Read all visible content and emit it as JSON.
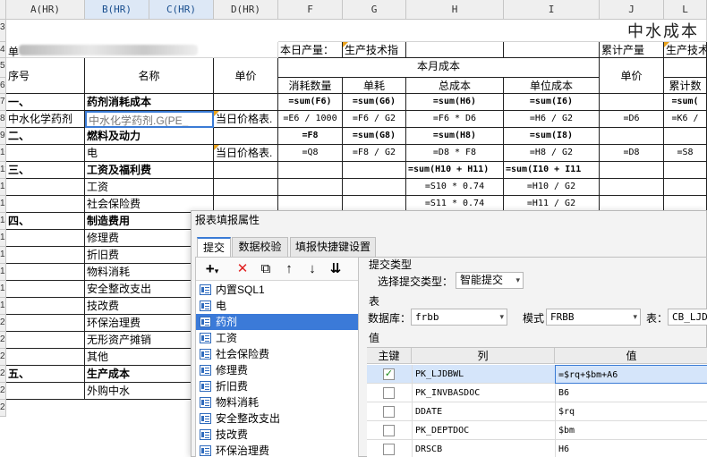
{
  "sheet": {
    "col_headers": [
      "A(HR)",
      "B(HR)",
      "C(HR)",
      "D(HR)",
      "F",
      "G",
      "H",
      "I",
      "J",
      "L"
    ],
    "row_headers": [
      "3",
      "4",
      "5",
      "6",
      "7",
      "8",
      "9",
      "10",
      "11",
      "12",
      "13",
      "14",
      "15",
      "16",
      "17",
      "18",
      "19",
      "20",
      "21",
      "22",
      "23",
      "24",
      "25"
    ],
    "title": "中水成本",
    "row4_prefix": "单",
    "daily_output_label": "本日产量：",
    "daily_output_value": "生产技术指",
    "cumulative_output_label": "累计产量",
    "cumulative_output_value": "生产技术",
    "monthly_cost_label": "本月成本",
    "col_seq": "序号",
    "col_name": "名称",
    "col_price": "单价",
    "col_consumption": "消耗数量",
    "col_unit_consumption": "单耗",
    "col_total_cost": "总成本",
    "col_unit_cost": "单位成本",
    "col_price2": "单价",
    "col_cumulative": "累计数",
    "rows": [
      {
        "seq": "一、",
        "name": "药剂消耗成本",
        "price": "",
        "f": "=sum(F6)",
        "g": "=sum(G6)",
        "h": "=sum(H6)",
        "i": "=sum(I6)",
        "j": "",
        "l": "=sum("
      },
      {
        "seq": "中水化学药剂",
        "name": "中水化学药剂.G(PE_",
        "price": "当日价格表.",
        "f": "=E6 / 1000",
        "g": "=F6 / G2",
        "h": "=F6 * D6",
        "i": "=H6 / G2",
        "j": "=D6",
        "l": "=K6 /"
      },
      {
        "seq": "二、",
        "name": "燃料及动力",
        "price": "",
        "f": "=F8",
        "g": "=sum(G8)",
        "h": "=sum(H8)",
        "i": "=sum(I8)",
        "j": "",
        "l": ""
      },
      {
        "seq": "",
        "name": "电",
        "price": "当日价格表.",
        "f": "=Q8",
        "g": "=F8 / G2",
        "h": "=D8 * F8",
        "i": "=H8 / G2",
        "j": "=D8",
        "l": "=S8"
      },
      {
        "seq": "三、",
        "name": "工资及福利费",
        "price": "",
        "f": "",
        "g": "",
        "h": "=sum(H10 + H11)",
        "i": "=sum(I10 + I11",
        "j": "",
        "l": ""
      },
      {
        "seq": "",
        "name": "工资",
        "price": "",
        "f": "",
        "g": "",
        "h": "=S10 * 0.74",
        "i": "=H10 / G2",
        "j": "",
        "l": ""
      },
      {
        "seq": "",
        "name": "社会保险费",
        "price": "",
        "f": "",
        "g": "",
        "h": "=S11 * 0.74",
        "i": "=H11 / G2",
        "j": "",
        "l": ""
      },
      {
        "seq": "四、",
        "name": "制造费用",
        "price": "",
        "f": "",
        "g": "",
        "h": "",
        "i": "",
        "j": "",
        "l": ""
      },
      {
        "seq": "",
        "name": "修理费",
        "price": "",
        "f": "",
        "g": "",
        "h": "",
        "i": "",
        "j": "",
        "l": ""
      },
      {
        "seq": "",
        "name": "折旧费",
        "price": "",
        "f": "",
        "g": "",
        "h": "",
        "i": "",
        "j": "",
        "l": ""
      },
      {
        "seq": "",
        "name": "物料消耗",
        "price": "",
        "f": "",
        "g": "",
        "h": "",
        "i": "",
        "j": "",
        "l": ""
      },
      {
        "seq": "",
        "name": "安全整改支出",
        "price": "",
        "f": "",
        "g": "",
        "h": "",
        "i": "",
        "j": "",
        "l": ""
      },
      {
        "seq": "",
        "name": "技改费",
        "price": "",
        "f": "",
        "g": "",
        "h": "",
        "i": "",
        "j": "",
        "l": ""
      },
      {
        "seq": "",
        "name": "环保治理费",
        "price": "",
        "f": "",
        "g": "",
        "h": "",
        "i": "",
        "j": "",
        "l": ""
      },
      {
        "seq": "",
        "name": "无形资产摊销",
        "price": "",
        "f": "",
        "g": "",
        "h": "",
        "i": "",
        "j": "",
        "l": ""
      },
      {
        "seq": "",
        "name": "其他",
        "price": "",
        "f": "",
        "g": "",
        "h": "",
        "i": "",
        "j": "",
        "l": ""
      },
      {
        "seq": "五、",
        "name": "生产成本",
        "price": "",
        "f": "",
        "g": "",
        "h": "",
        "i": "",
        "j": "",
        "l": ""
      },
      {
        "seq": "",
        "name": "外购中水",
        "price": "",
        "f": "",
        "g": "",
        "h": "",
        "i": "",
        "j": "",
        "l": ""
      }
    ]
  },
  "dialog": {
    "title": "报表填报属性",
    "tabs": [
      {
        "label": "提交",
        "active": true
      },
      {
        "label": "数据校验",
        "active": false
      },
      {
        "label": "填报快捷键设置",
        "active": false
      }
    ],
    "toolbar": {
      "add_glyph": "+",
      "add_arrow": "▾",
      "delete_glyph": "✕",
      "copy_glyph": "⧉",
      "up_glyph": "↑",
      "down_glyph": "↓",
      "sort_glyph": "⇊"
    },
    "tree_items": [
      "内置SQL1",
      "电",
      "药剂",
      "工资",
      "社会保险费",
      "修理费",
      "折旧费",
      "物料消耗",
      "安全整改支出",
      "技改费",
      "环保治理费"
    ],
    "tree_selected_index": 2,
    "submit_type_section": "提交类型",
    "submit_type_label": "选择提交类型：",
    "submit_type_value": "智能提交",
    "table_section": "表",
    "database_label": "数据库：",
    "database_value": "frbb",
    "schema_label": "模式：",
    "schema_value": "FRBB",
    "table_label": "表：",
    "table_value": "CB_LJDB",
    "value_section": "值",
    "grid_headers": {
      "key": "主键",
      "column": "列",
      "value": "值"
    },
    "grid_rows": [
      {
        "key": true,
        "column": "PK_LJDBWL",
        "value": "=$rq+$bm+A6"
      },
      {
        "key": false,
        "column": "PK_INVBASDOC",
        "value": "B6"
      },
      {
        "key": false,
        "column": "DDATE",
        "value": "$rq"
      },
      {
        "key": false,
        "column": "PK_DEPTDOC",
        "value": "$bm"
      },
      {
        "key": false,
        "column": "DRSCB",
        "value": "H6"
      }
    ],
    "grid_highlight_index": 0,
    "check_glyph": "✓",
    "arrow_glyph": "▾"
  },
  "colors": {
    "accent": "#3a7bd5",
    "selection": "#3b7ad8",
    "comment_marker": "#e9a11b",
    "header_bg": "#efefef"
  }
}
